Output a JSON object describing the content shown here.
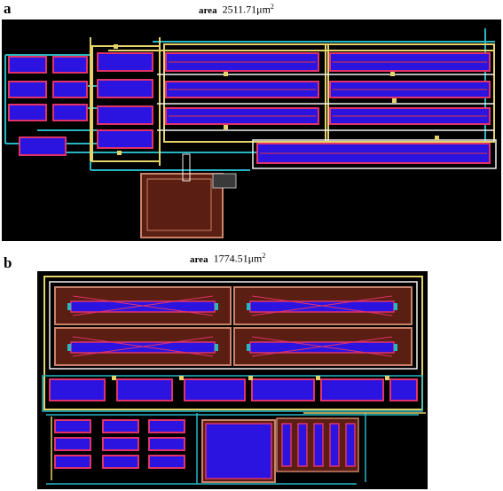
{
  "panels": [
    {
      "letter": "a",
      "area_label": "area",
      "area_value": "2511.71μm",
      "area_exponent": "2"
    },
    {
      "letter": "b",
      "area_label": "area",
      "area_value": "1774.51μm",
      "area_exponent": "2"
    }
  ],
  "colors": {
    "background": "#000000",
    "active_fill": "#2b14e0",
    "active_border": "#e0336a",
    "poly": "#d83a3a",
    "metal_yellow": "#e5d36a",
    "metal_cyan": "#27b6c4",
    "metal_white": "#f2f2f2",
    "well_brown": "#5a1e12",
    "well_border": "#c9836a"
  }
}
